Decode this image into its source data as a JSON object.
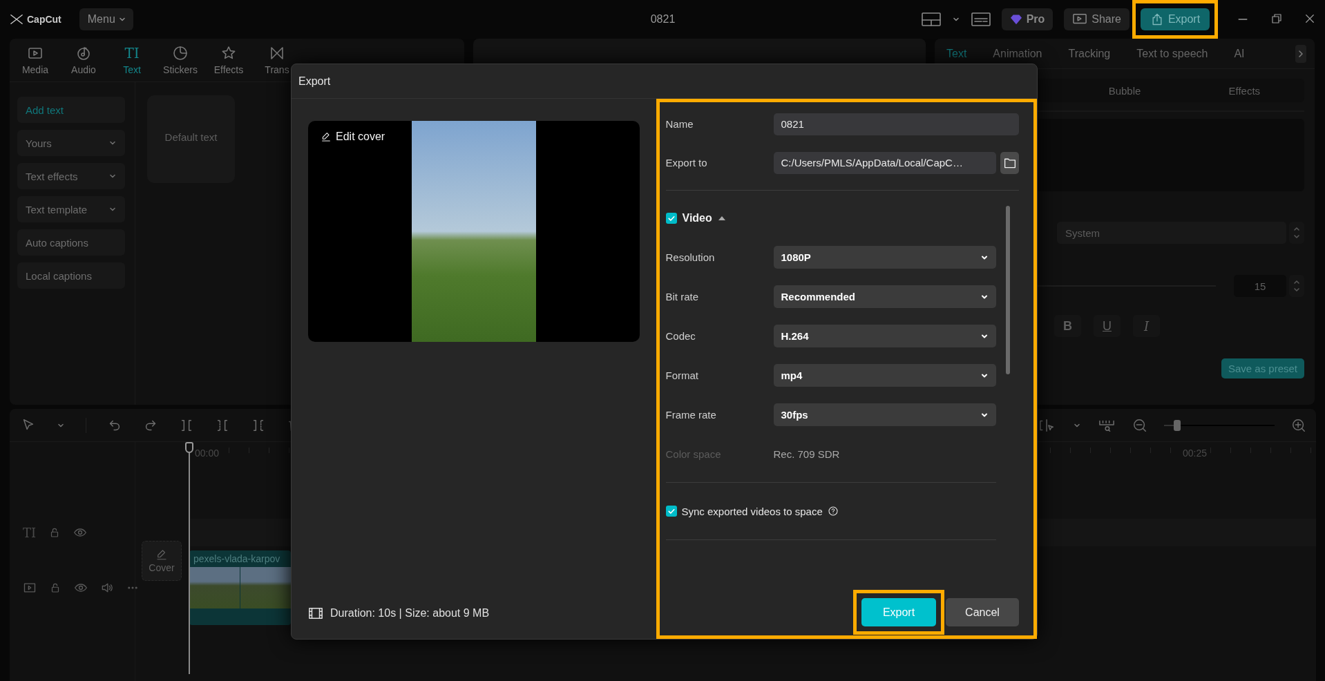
{
  "top_bar": {
    "app_name": "CapCut",
    "menu": "Menu",
    "title": "0821",
    "pro": "Pro",
    "share": "Share",
    "export": {
      "label": "Export",
      "highlighted": true
    }
  },
  "media_panel": {
    "tabs": [
      {
        "label": "Media",
        "selected": false
      },
      {
        "label": "Audio",
        "selected": false
      },
      {
        "label": "Text",
        "icon_text": "TI",
        "selected": true
      },
      {
        "label": "Stickers",
        "selected": false
      },
      {
        "label": "Effects",
        "selected": false
      },
      {
        "label": "Trans",
        "selected": false
      }
    ],
    "categories": [
      {
        "label": "Add text",
        "kind": "item",
        "selected": true
      },
      {
        "label": "Yours",
        "kind": "group",
        "selected": false
      },
      {
        "label": "Text effects",
        "kind": "group",
        "selected": false
      },
      {
        "label": "Text template",
        "kind": "group",
        "selected": false
      },
      {
        "label": "Auto captions",
        "kind": "item",
        "selected": false
      },
      {
        "label": "Local captions",
        "kind": "item",
        "selected": false
      }
    ],
    "presets": [
      "Default text"
    ]
  },
  "properties_panel": {
    "tabs": [
      {
        "label": "Text",
        "selected": true
      },
      {
        "label": "Animation",
        "selected": false
      },
      {
        "label": "Tracking",
        "selected": false
      },
      {
        "label": "Text to speech",
        "selected": false
      },
      {
        "label": "AI",
        "selected": false
      }
    ],
    "subtabs": [
      {
        "label": "Bubble",
        "selected": false
      },
      {
        "label": "Effects",
        "selected": false
      }
    ],
    "font": "System",
    "size": "15",
    "styles": [
      {
        "label": "B",
        "kind": "bold"
      },
      {
        "label": "U",
        "kind": "underline"
      },
      {
        "label": "I",
        "kind": "italic"
      }
    ],
    "save_preset": "Save as preset"
  },
  "timeline": {
    "zoom": {
      "level": 0.12
    },
    "ruler": [
      "00:00",
      "00:25"
    ],
    "tracks": [
      {
        "kind": "text",
        "icon_text": "TI"
      },
      {
        "kind": "video",
        "cover": "Cover",
        "clip": "pexels-vlada-karpov"
      }
    ]
  },
  "dialog": {
    "title": "Export",
    "cover_label": "Edit cover",
    "summary": "Duration: 10s | Size: about 9 MB",
    "settings": {
      "highlighted": true,
      "fields": [
        {
          "label": "Name",
          "value": "0821",
          "kind": "text"
        },
        {
          "label": "Export to",
          "value": "C:/Users/PMLS/AppData/Local/CapC…",
          "kind": "path"
        }
      ],
      "video": {
        "label": "Video",
        "checked": true,
        "expanded": true
      },
      "options": [
        {
          "label": "Resolution",
          "value": "1080P",
          "kind": "dropdown"
        },
        {
          "label": "Bit rate",
          "value": "Recommended",
          "kind": "dropdown"
        },
        {
          "label": "Codec",
          "value": "H.264",
          "kind": "dropdown"
        },
        {
          "label": "Format",
          "value": "mp4",
          "kind": "dropdown"
        },
        {
          "label": "Frame rate",
          "value": "30fps",
          "kind": "dropdown"
        },
        {
          "label": "Color space",
          "value": "Rec. 709 SDR",
          "kind": "static"
        }
      ],
      "sync": {
        "label": "Sync exported videos to space",
        "checked": true
      }
    },
    "buttons": [
      {
        "label": "Export",
        "kind": "primary",
        "highlighted": true
      },
      {
        "label": "Cancel",
        "kind": "secondary",
        "highlighted": false
      }
    ]
  }
}
